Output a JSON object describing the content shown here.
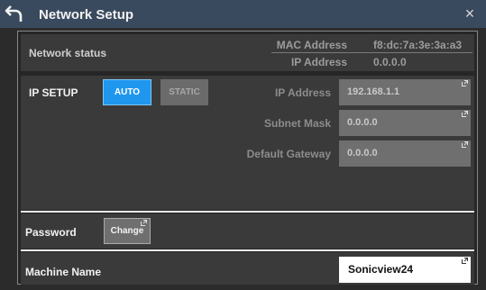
{
  "window": {
    "title": "Network Setup",
    "back_icon": "back-arrow-icon",
    "close_symbol": "×"
  },
  "network_status": {
    "label": "Network status",
    "mac_label": "MAC Address",
    "mac_value": "f8:dc:7a:3e:3a:a3",
    "ip_label": "IP Address",
    "ip_value": "0.0.0.0"
  },
  "ip_setup": {
    "label": "IP SETUP",
    "auto_label": "AUTO",
    "static_label": "STATIC",
    "selected_mode": "AUTO",
    "fields": [
      {
        "label": "IP Address",
        "value": "192.168.1.1"
      },
      {
        "label": "Subnet Mask",
        "value": "0.0.0.0"
      },
      {
        "label": "Default Gateway",
        "value": "0.0.0.0"
      }
    ]
  },
  "password": {
    "label": "Password",
    "change_label": "Change"
  },
  "machine_name": {
    "label": "Machine Name",
    "value": "Sonicview24"
  },
  "colors": {
    "titlebar": "#3a4a5e",
    "accent": "#1f97ee",
    "panel": "#3a3a3a",
    "background": "#262626"
  }
}
